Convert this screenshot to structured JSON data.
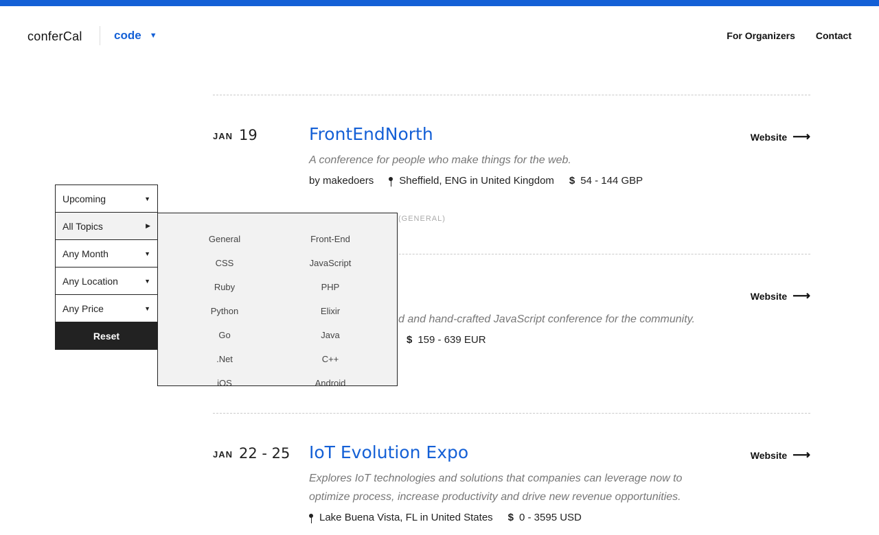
{
  "header": {
    "logo": "conferCal",
    "category": "code",
    "nav": [
      "For Organizers",
      "Contact"
    ]
  },
  "colors": {
    "accent": "#1460d6",
    "dark": "#222222",
    "menu_bg": "#f2f2f2"
  },
  "filters": {
    "items": [
      "Upcoming",
      "All Topics",
      "Any Month",
      "Any Location",
      "Any Price"
    ],
    "reset": "Reset"
  },
  "topics_menu": [
    "General",
    "Front-End",
    "CSS",
    "JavaScript",
    "Ruby",
    "PHP",
    "Python",
    "Elixir",
    "Go",
    "Java",
    ".Net",
    "C++",
    "iOS",
    "Android"
  ],
  "events": [
    {
      "month": "JAN",
      "days": "19",
      "title": "FrontEndNorth",
      "description": "A conference for people who make things for the web.",
      "organizer": "by makedoers",
      "location": "Sheffield, ENG in United Kingdom",
      "price": "54 - 144 GBP",
      "tag": "(GENERAL)",
      "website": "Website"
    },
    {
      "description_visible": "d and hand-crafted JavaScript conference for the community.",
      "price": "159 - 639 EUR",
      "website": "Website"
    },
    {
      "month": "JAN",
      "days": "22 - 25",
      "title": "IoT Evolution Expo",
      "description": "Explores IoT technologies and solutions that companies can leverage now to optimize process, increase productivity and drive new revenue opportunities.",
      "location": "Lake Buena Vista, FL in United States",
      "price": "0 - 3595 USD",
      "website": "Website"
    }
  ],
  "icons": {
    "dropdown": "caret-down-icon",
    "submenu": "caret-right-icon",
    "location": "pin-icon",
    "price": "dollar-icon",
    "link": "arrow-right-icon"
  }
}
